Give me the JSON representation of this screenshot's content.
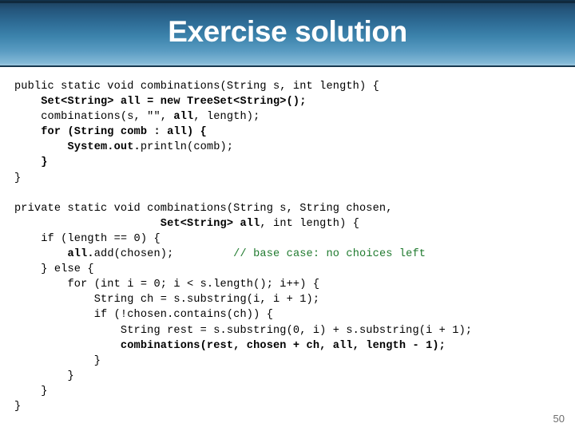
{
  "slide": {
    "title": "Exercise solution",
    "slide_number": "50",
    "comment_color": "#1f7a2e",
    "banner_color_top": "#1c3f5c",
    "banner_color_bottom": "#9dc8e0"
  },
  "code": {
    "lines": [
      {
        "tokens": [
          {
            "t": "public static void combinations(String s, int length) {",
            "w": "n"
          }
        ]
      },
      {
        "tokens": [
          {
            "t": "    Set<String> all = new TreeSet<String>();",
            "w": "b"
          }
        ]
      },
      {
        "tokens": [
          {
            "t": "    combinations(s, \"\", ",
            "w": "n"
          },
          {
            "t": "all",
            "w": "b"
          },
          {
            "t": ", length);",
            "w": "n"
          }
        ]
      },
      {
        "tokens": [
          {
            "t": "    for (String comb : all) {",
            "w": "b"
          }
        ]
      },
      {
        "tokens": [
          {
            "t": "        System.out.",
            "w": "b"
          },
          {
            "t": "println(comb);",
            "w": "n"
          }
        ]
      },
      {
        "tokens": [
          {
            "t": "    }",
            "w": "b"
          }
        ]
      },
      {
        "tokens": [
          {
            "t": "}",
            "w": "n"
          }
        ]
      },
      {
        "tokens": [
          {
            "t": "",
            "w": "n"
          }
        ]
      },
      {
        "tokens": [
          {
            "t": "private static void combinations(String s, String chosen,",
            "w": "n"
          }
        ]
      },
      {
        "tokens": [
          {
            "t": "                      ",
            "w": "n"
          },
          {
            "t": "Set<String> all",
            "w": "b"
          },
          {
            "t": ", int length) {",
            "w": "n"
          }
        ]
      },
      {
        "tokens": [
          {
            "t": "    if (length == 0) {",
            "w": "n"
          }
        ]
      },
      {
        "tokens": [
          {
            "t": "        ",
            "w": "n"
          },
          {
            "t": "all.",
            "w": "b"
          },
          {
            "t": "add(chosen);         ",
            "w": "n"
          },
          {
            "t": "// base case: no choices left",
            "w": "c"
          }
        ]
      },
      {
        "tokens": [
          {
            "t": "    } else {",
            "w": "n"
          }
        ]
      },
      {
        "tokens": [
          {
            "t": "        for (int i = 0; i < s.length(); i++) {",
            "w": "n"
          }
        ]
      },
      {
        "tokens": [
          {
            "t": "            String ch = s.substring(i, i + 1);",
            "w": "n"
          }
        ]
      },
      {
        "tokens": [
          {
            "t": "            if (!chosen.contains(ch)) {",
            "w": "n"
          }
        ]
      },
      {
        "tokens": [
          {
            "t": "                String rest = s.substring(0, i) + s.substring(i + 1);",
            "w": "n"
          }
        ]
      },
      {
        "tokens": [
          {
            "t": "                combinations(rest, chosen + ch, all, length - 1);",
            "w": "b"
          }
        ]
      },
      {
        "tokens": [
          {
            "t": "            }",
            "w": "n"
          }
        ]
      },
      {
        "tokens": [
          {
            "t": "        }",
            "w": "n"
          }
        ]
      },
      {
        "tokens": [
          {
            "t": "    }",
            "w": "n"
          }
        ]
      },
      {
        "tokens": [
          {
            "t": "}",
            "w": "n"
          }
        ]
      }
    ]
  }
}
